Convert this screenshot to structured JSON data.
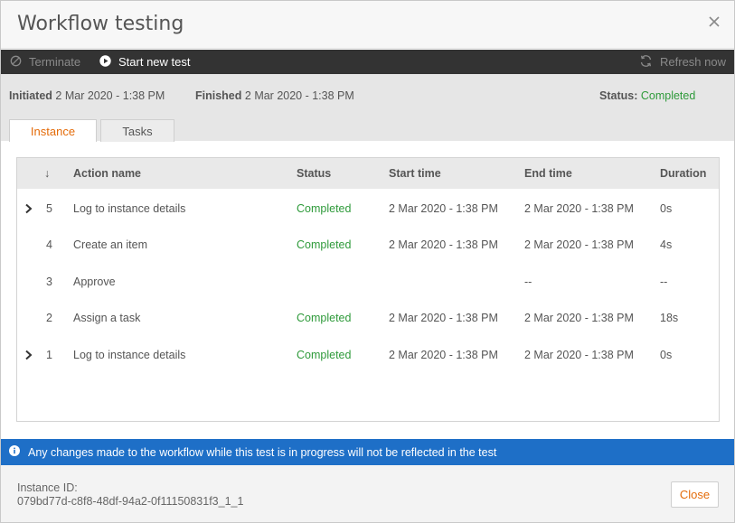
{
  "dialog": {
    "title": "Workflow testing"
  },
  "toolbar": {
    "terminate_label": "Terminate",
    "start_label": "Start new test",
    "refresh_label": "Refresh now"
  },
  "info": {
    "initiated_label": "Initiated",
    "initiated_value": "2 Mar 2020 - 1:38 PM",
    "finished_label": "Finished",
    "finished_value": "2 Mar 2020 - 1:38 PM",
    "status_label": "Status:",
    "status_value": "Completed"
  },
  "tabs": [
    {
      "label": "Instance",
      "active": true
    },
    {
      "label": "Tasks",
      "active": false
    }
  ],
  "table": {
    "columns": {
      "sort_glyph": "↓",
      "action_name": "Action name",
      "status": "Status",
      "start_time": "Start time",
      "end_time": "End time",
      "duration": "Duration"
    },
    "rows": [
      {
        "expandable": true,
        "num": "5",
        "name": "Log to instance details",
        "status": "Completed",
        "start": "2 Mar 2020 - 1:38 PM",
        "end": "2 Mar 2020 - 1:38 PM",
        "duration": "0s"
      },
      {
        "expandable": false,
        "num": "4",
        "name": "Create an item",
        "status": "Completed",
        "start": "2 Mar 2020 - 1:38 PM",
        "end": "2 Mar 2020 - 1:38 PM",
        "duration": "4s"
      },
      {
        "expandable": false,
        "num": "3",
        "name": "Approve",
        "status": "",
        "start": "",
        "end": "--",
        "duration": "--"
      },
      {
        "expandable": false,
        "num": "2",
        "name": "Assign a task",
        "status": "Completed",
        "start": "2 Mar 2020 - 1:38 PM",
        "end": "2 Mar 2020 - 1:38 PM",
        "duration": "18s"
      },
      {
        "expandable": true,
        "num": "1",
        "name": "Log to instance details",
        "status": "Completed",
        "start": "2 Mar 2020 - 1:38 PM",
        "end": "2 Mar 2020 - 1:38 PM",
        "duration": "0s"
      }
    ]
  },
  "notice": {
    "text": "Any changes made to the workflow while this test is in progress will not be reflected in the test"
  },
  "footer": {
    "instance_id_label": "Instance ID:",
    "instance_id_value": "079bd77d-c8f8-48df-94a2-0f11150831f3_1_1",
    "close_label": "Close"
  },
  "colors": {
    "toolbar_bg": "#333333",
    "accent_orange": "#e46c0a",
    "status_green": "#2e9a3a",
    "notice_blue": "#1e6fc7"
  },
  "icons": {
    "close": "close-icon",
    "terminate": "ban-icon",
    "start": "play-circle-icon",
    "refresh": "refresh-icon",
    "info": "info-circle-icon",
    "expand": "chevron-right-icon"
  }
}
